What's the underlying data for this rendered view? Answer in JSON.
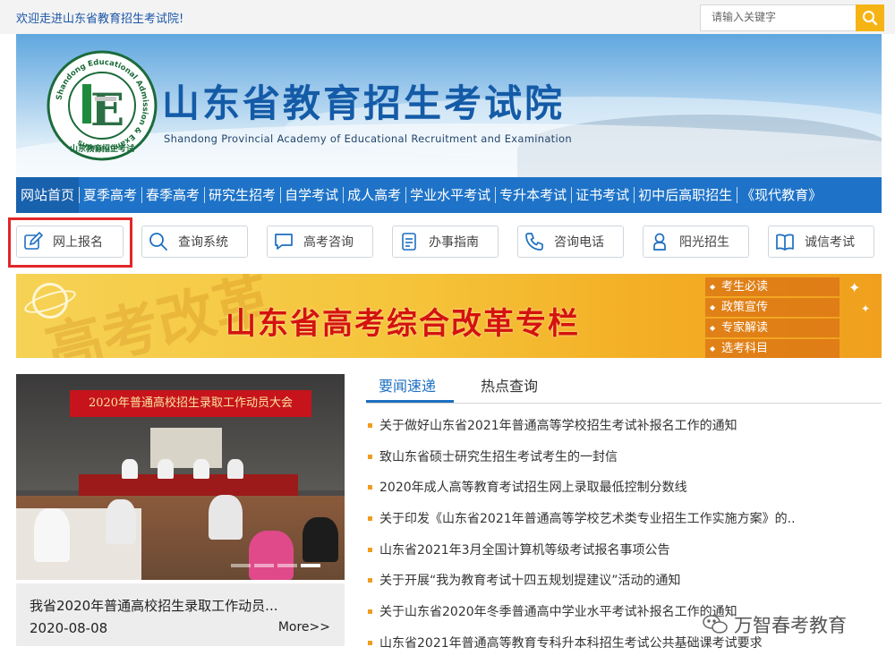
{
  "topbar": {
    "welcome": "欢迎走进山东省教育招生考试院!",
    "search_placeholder": "请输入关键字"
  },
  "header": {
    "title": "山东省教育招生考试院",
    "subtitle": "Shandong Provincial Academy of Educational Recruitment and Examination",
    "logo_ring_text": "Shandong Educational Admission & Examinations",
    "logo_bottom_text": "山东教育招生考试",
    "logo_letter": "E"
  },
  "nav": {
    "items": [
      "网站首页",
      "夏季高考",
      "春季高考",
      "研究生招考",
      "自学考试",
      "成人高考",
      "学业水平考试",
      "专升本考试",
      "证书考试",
      "初中后高职招生",
      "《现代教育》"
    ]
  },
  "quick_links": [
    {
      "label": "网上报名",
      "icon": "pencil-icon"
    },
    {
      "label": "查询系统",
      "icon": "search-icon"
    },
    {
      "label": "高考咨询",
      "icon": "chat-bubble-icon"
    },
    {
      "label": "办事指南",
      "icon": "document-icon"
    },
    {
      "label": "咨询电话",
      "icon": "phone-icon"
    },
    {
      "label": "阳光招生",
      "icon": "person-icon"
    },
    {
      "label": "诚信考试",
      "icon": "book-icon"
    }
  ],
  "promo": {
    "title": "山东省高考综合改革专栏",
    "background_text": "高考改革",
    "links": [
      "考生必读",
      "政策宣传",
      "专家解读",
      "选考科目"
    ]
  },
  "featured": {
    "photo_banner": "2020年普通高校招生录取工作动员大会",
    "title": "我省2020年普通高校招生录取工作动员...",
    "date": "2020-08-08",
    "more": "More>>"
  },
  "tabs": [
    "要闻速递",
    "热点查询"
  ],
  "news": [
    "关于做好山东省2021年普通高等学校招生考试补报名工作的通知",
    "致山东省硕士研究生招生考试考生的一封信",
    "2020年成人高等教育考试招生网上录取最低控制分数线",
    "关于印发《山东省2021年普通高等学校艺术类专业招生工作实施方案》的..",
    "山东省2021年3月全国计算机等级考试报名事项公告",
    "关于开展“我为教育考试十四五规划提建议”活动的通知",
    "关于山东省2020年冬季普通高中学业水平考试补报名工作的通知",
    "山东省2021年普通高等教育专科升本科招生考试公共基础课考试要求"
  ],
  "watermark": "万智春考教育",
  "colors": {
    "brand_blue": "#1e73c8",
    "accent_orange": "#f6b414",
    "highlight_red": "#e3262a",
    "promo_red": "#d4130f"
  }
}
